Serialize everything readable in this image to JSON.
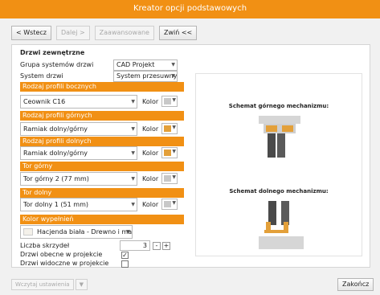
{
  "window": {
    "title": "Kreator opcji podstawowych"
  },
  "toolbar": {
    "back": "< Wstecz",
    "next": "Dalej >",
    "advanced": "Zaawansowane",
    "collapse": "Zwiń <<"
  },
  "section": {
    "title": "Drzwi zewnętrzne"
  },
  "form": {
    "system_group_label": "Grupa systemów drzwi",
    "system_group_value": "CAD Projekt",
    "door_system_label": "System drzwi",
    "door_system_value": "System przesuwny",
    "color_label": "Kolor",
    "side_profile": {
      "header": "Rodzaj profili bocznych",
      "value": "Ceownik C16",
      "color": "#c8c8c8"
    },
    "top_profile": {
      "header": "Rodzaj profili górnych",
      "value": "Ramiak dolny/górny",
      "color": "#e3a03a"
    },
    "bottom_profile": {
      "header": "Rodzaj profili dolnych",
      "value": "Ramiak dolny/górny",
      "color": "#e3a03a"
    },
    "top_track": {
      "header": "Tor górny",
      "value": "Tor górny 2 (77 mm)",
      "color": "#c8c8c8"
    },
    "bottom_track": {
      "header": "Tor dolny",
      "value": "Tor dolny 1 (51 mm)",
      "color": "#c8c8c8"
    },
    "fill_color": {
      "header": "Kolor wypełnień",
      "value": "Hacjenda biała - Drewno i mat"
    },
    "door_count_label": "Liczba skrzydeł",
    "door_count_value": "3",
    "minus": "-",
    "plus": "+",
    "door_visible_label": "Drzwi obecne w projekcie",
    "door_visible_checked": "✓",
    "door_visible_in_project_label": "Drzwi widoczne w projekcie"
  },
  "preview": {
    "top_title": "Schemat górnego mechanizmu:",
    "bottom_title": "Schemat dolnego mechanizmu:"
  },
  "footer": {
    "load_settings": "Wczytaj ustawienia",
    "finish": "Zakończ"
  },
  "colors": {
    "accent": "#f19014",
    "rail_gray": "#d6d6d6",
    "dark_panel": "#4a4a4a"
  }
}
